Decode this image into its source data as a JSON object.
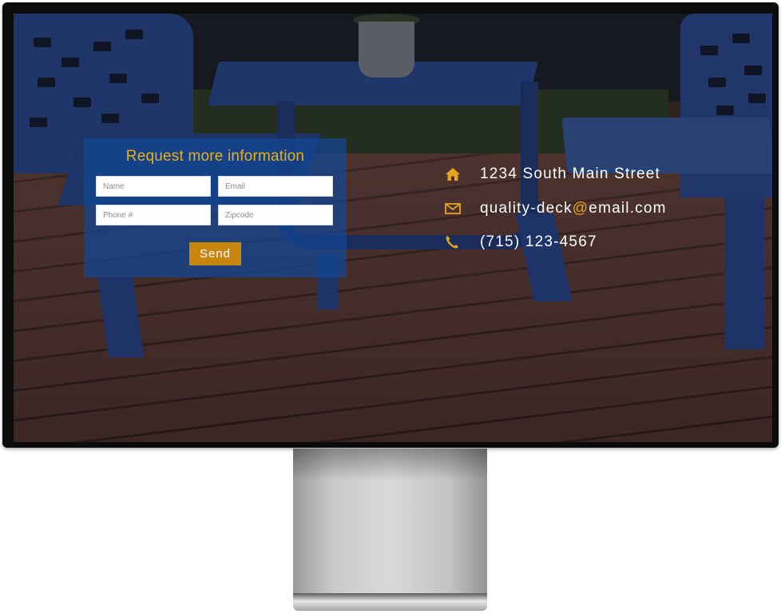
{
  "form": {
    "title": "Request more information",
    "name_placeholder": "Name",
    "email_placeholder": "Email",
    "phone_placeholder": "Phone #",
    "zipcode_placeholder": "Zipcode",
    "send_label": "Send"
  },
  "contact": {
    "address": "1234 South Main Street",
    "email_user": "quality-deck",
    "email_at": "@",
    "email_domain": "email.com",
    "phone": "(715) 123-4567"
  },
  "icons": {
    "address": "home-icon",
    "email": "envelope-icon",
    "phone": "phone-icon"
  },
  "colors": {
    "accent": "#c9860f",
    "title": "#e7b11c",
    "panel": "#12469a"
  }
}
